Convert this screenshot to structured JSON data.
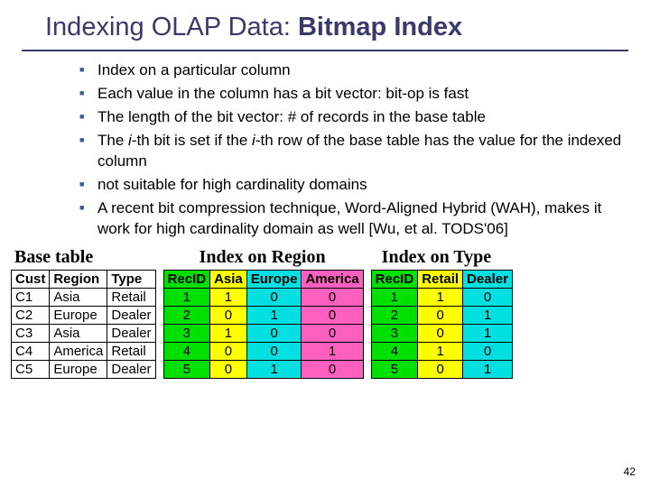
{
  "title_plain": "Indexing OLAP Data: ",
  "title_bold": "Bitmap Index",
  "bullets": {
    "b0": "Index on a particular column",
    "b1": "Each value in the column has a bit vector: bit-op is fast",
    "b2": "The length of the bit vector: # of records in the base table",
    "b3a": "The  ",
    "b3i1": "i",
    "b3b": "-th bit is set if the  ",
    "b3i2": "i",
    "b3c": "-th row of the base table has the value for the indexed column",
    "b4": "not suitable for high cardinality domains",
    "b5": "A recent bit compression technique, Word-Aligned Hybrid (WAH), makes it work for high cardinality domain as well [Wu, et al. TODS'06]"
  },
  "captions": {
    "base": "Base table",
    "region": "Index on Region",
    "type": "Index on Type"
  },
  "base_table": {
    "head": {
      "c0": "Cust",
      "c1": "Region",
      "c2": "Type"
    },
    "rows": [
      {
        "c0": "C1",
        "c1": "Asia",
        "c2": "Retail"
      },
      {
        "c0": "C2",
        "c1": "Europe",
        "c2": "Dealer"
      },
      {
        "c0": "C3",
        "c1": "Asia",
        "c2": "Dealer"
      },
      {
        "c0": "C4",
        "c1": "America",
        "c2": "Retail"
      },
      {
        "c0": "C5",
        "c1": "Europe",
        "c2": "Dealer"
      }
    ]
  },
  "region_index": {
    "head": {
      "c0": "RecID",
      "c1": "Asia",
      "c2": "Europe",
      "c3": "America"
    },
    "rows": [
      {
        "c0": "1",
        "c1": "1",
        "c2": "0",
        "c3": "0"
      },
      {
        "c0": "2",
        "c1": "0",
        "c2": "1",
        "c3": "0"
      },
      {
        "c0": "3",
        "c1": "1",
        "c2": "0",
        "c3": "0"
      },
      {
        "c0": "4",
        "c1": "0",
        "c2": "0",
        "c3": "1"
      },
      {
        "c0": "5",
        "c1": "0",
        "c2": "1",
        "c3": "0"
      }
    ]
  },
  "type_index": {
    "head": {
      "c0": "RecID",
      "c1": "Retail",
      "c2": "Dealer"
    },
    "rows": [
      {
        "c0": "1",
        "c1": "1",
        "c2": "0"
      },
      {
        "c0": "2",
        "c1": "0",
        "c2": "1"
      },
      {
        "c0": "3",
        "c1": "0",
        "c2": "1"
      },
      {
        "c0": "4",
        "c1": "1",
        "c2": "0"
      },
      {
        "c0": "5",
        "c1": "0",
        "c2": "1"
      }
    ]
  },
  "pagenum": "42"
}
